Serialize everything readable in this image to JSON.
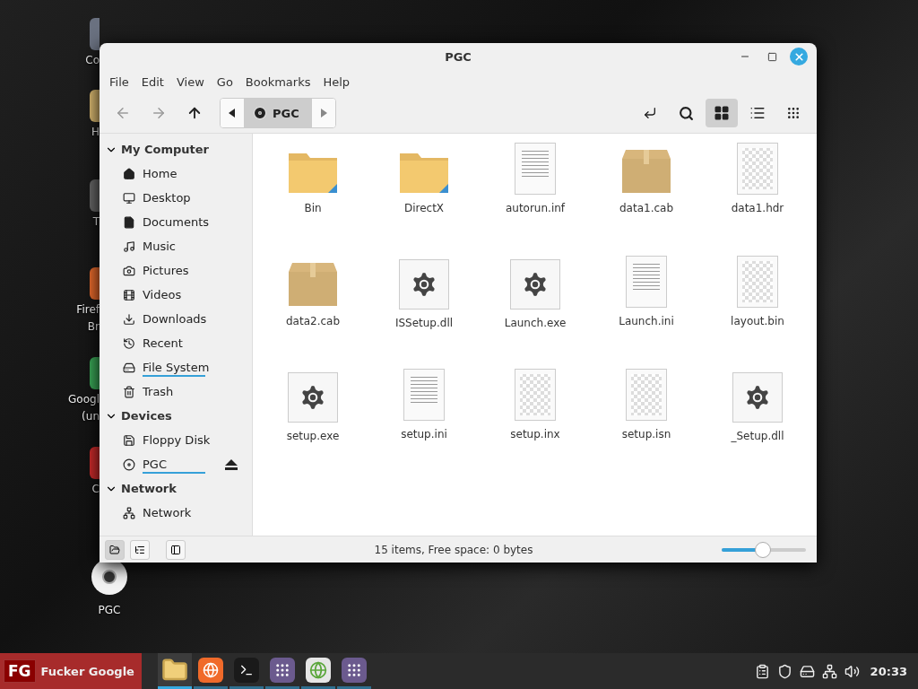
{
  "desktop_icons": [
    {
      "kind": "computer",
      "lines": [
        "Co"
      ]
    },
    {
      "kind": "folder",
      "lines": [
        "H"
      ]
    },
    {
      "kind": "trash",
      "lines": [
        "T"
      ]
    },
    {
      "kind": "firefox",
      "lines": [
        "Firef",
        "Br"
      ]
    },
    {
      "kind": "chrome",
      "lines": [
        "Googl",
        "(un"
      ]
    },
    {
      "kind": "red",
      "lines": [
        "C"
      ]
    }
  ],
  "desktop_disc": {
    "label": "PGC"
  },
  "window": {
    "title": "PGC"
  },
  "menu": [
    "File",
    "Edit",
    "View",
    "Go",
    "Bookmarks",
    "Help"
  ],
  "toolbar": {
    "back_disabled": true,
    "forward_disabled": true,
    "location": "PGC",
    "views": [
      {
        "kind": "icons",
        "selected": true
      },
      {
        "kind": "list",
        "selected": false
      },
      {
        "kind": "compact",
        "selected": false
      }
    ]
  },
  "sidebar": [
    {
      "label": "My Computer",
      "expanded": true,
      "children": [
        {
          "label": "Home",
          "kind": "home"
        },
        {
          "label": "Desktop",
          "kind": "desktop"
        },
        {
          "label": "Documents",
          "kind": "documents"
        },
        {
          "label": "Music",
          "kind": "music"
        },
        {
          "label": "Pictures",
          "kind": "pictures"
        },
        {
          "label": "Videos",
          "kind": "videos"
        },
        {
          "label": "Downloads",
          "kind": "downloads"
        },
        {
          "label": "Recent",
          "kind": "recent"
        },
        {
          "label": "File System",
          "kind": "drive",
          "level": 1
        },
        {
          "label": "Trash",
          "kind": "trash"
        }
      ]
    },
    {
      "label": "Devices",
      "expanded": true,
      "children": [
        {
          "label": "Floppy Disk",
          "kind": "floppy"
        },
        {
          "label": "PGC",
          "kind": "disc",
          "level": 1,
          "eject": true
        }
      ]
    },
    {
      "label": "Network",
      "expanded": true,
      "children": [
        {
          "label": "Network",
          "kind": "network"
        }
      ]
    }
  ],
  "files": [
    {
      "name": "Bin",
      "kind": "folder"
    },
    {
      "name": "DirectX",
      "kind": "folder"
    },
    {
      "name": "autorun.inf",
      "kind": "text"
    },
    {
      "name": "data1.cab",
      "kind": "archive"
    },
    {
      "name": "data1.hdr",
      "kind": "binary"
    },
    {
      "name": "data2.cab",
      "kind": "archive"
    },
    {
      "name": "ISSetup.dll",
      "kind": "exec"
    },
    {
      "name": "Launch.exe",
      "kind": "exec"
    },
    {
      "name": "Launch.ini",
      "kind": "text"
    },
    {
      "name": "layout.bin",
      "kind": "binary"
    },
    {
      "name": "setup.exe",
      "kind": "exec"
    },
    {
      "name": "setup.ini",
      "kind": "text"
    },
    {
      "name": "setup.inx",
      "kind": "binary"
    },
    {
      "name": "setup.isn",
      "kind": "binary"
    },
    {
      "name": "_Setup.dll",
      "kind": "exec"
    }
  ],
  "status_bar": {
    "panes": [
      {
        "kind": "places",
        "selected": true
      },
      {
        "kind": "tree",
        "selected": false
      }
    ],
    "text": "15 items, Free space: 0 bytes",
    "zoom": {
      "level": 0.48
    }
  },
  "taskbar": {
    "menu_label": "Fucker Google",
    "logo": "FG",
    "apps": [
      {
        "kind": "files",
        "active": true
      },
      {
        "kind": "firefox",
        "active": false
      },
      {
        "kind": "terminal",
        "active": false
      },
      {
        "kind": "apps",
        "active": false
      },
      {
        "kind": "globe",
        "active": false
      },
      {
        "kind": "apps",
        "active": false
      }
    ],
    "clock": "20:33"
  }
}
